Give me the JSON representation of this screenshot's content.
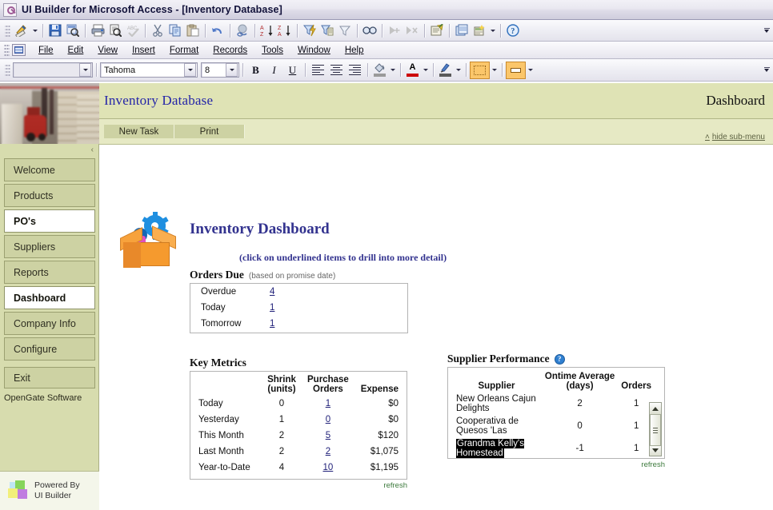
{
  "window": {
    "title": "UI Builder for Microsoft Access  - [Inventory Database]",
    "icon": "key-icon"
  },
  "menubar": {
    "items": [
      "File",
      "Edit",
      "View",
      "Insert",
      "Format",
      "Records",
      "Tools",
      "Window",
      "Help"
    ]
  },
  "toolbar": {
    "icons": [
      "design-view-icon",
      "save-icon",
      "search-replace-icon",
      "print-icon",
      "print-preview-icon",
      "spellcheck-icon",
      "cut-icon",
      "copy-icon",
      "paste-icon",
      "undo-icon",
      "insert-hyperlink-icon",
      "sort-ascending-icon",
      "sort-descending-icon",
      "filter-by-selection-icon",
      "filter-by-form-icon",
      "apply-filter-icon",
      "find-icon",
      "new-record-icon",
      "delete-record-icon",
      "properties-icon",
      "database-window-icon",
      "new-object-icon",
      "help-icon"
    ]
  },
  "formatbar": {
    "object_value": "",
    "font_value": "Tahoma",
    "size_value": "8",
    "bold_label": "B",
    "italic_label": "I",
    "underline_label": "U",
    "fill_glyph": "◢",
    "fontcolor_glyph": "A",
    "line_glyph": "✎",
    "fill_color": "#9a9a9a",
    "fontcolor_color": "#cc0000",
    "linecolor_color": "#5a5a5a"
  },
  "sidebar": {
    "collapse_glyph": "‹",
    "items": [
      {
        "label": "Welcome",
        "active": false
      },
      {
        "label": "Products",
        "active": false
      },
      {
        "label": "PO's",
        "active": true
      },
      {
        "label": "Suppliers",
        "active": false
      },
      {
        "label": "Reports",
        "active": false
      },
      {
        "label": "Dashboard",
        "active": true
      },
      {
        "label": "Company Info",
        "active": false
      },
      {
        "label": "Configure",
        "active": false
      }
    ],
    "exit_label": "Exit",
    "company": "OpenGate Software",
    "powered_line1": "Powered By",
    "powered_line2": "UI Builder"
  },
  "page_header": {
    "app_title": "Inventory Database",
    "section_title": "Dashboard",
    "buttons": [
      "New Task",
      "Print"
    ],
    "hide_submenu": "hide sub-menu",
    "hide_caret": "˄"
  },
  "dashboard": {
    "icon": "open-box-with-gears-icon",
    "title": "Inventory Dashboard",
    "subtitle": "(click on underlined items to drill into more detail)",
    "orders_due": {
      "heading": "Orders Due",
      "note": "(based on promise date)",
      "rows": [
        {
          "label": "Overdue",
          "value": "4",
          "link": true
        },
        {
          "label": "Today",
          "value": "1",
          "link": true
        },
        {
          "label": "Tomorrow",
          "value": "1",
          "link": true
        }
      ]
    },
    "key_metrics": {
      "heading": "Key Metrics",
      "columns": [
        "",
        "Shrink\n(units)",
        "Purchase\nOrders",
        "Expense"
      ],
      "col_shrink_l1": "Shrink",
      "col_shrink_l2": "(units)",
      "col_po_l1": "Purchase",
      "col_po_l2": "Orders",
      "col_expense": "Expense",
      "rows": [
        {
          "label": "Today",
          "shrink": "0",
          "orders": "1",
          "expense": "$0"
        },
        {
          "label": "Yesterday",
          "shrink": "1",
          "orders": "0",
          "expense": "$0"
        },
        {
          "label": "This Month",
          "shrink": "2",
          "orders": "5",
          "expense": "$120"
        },
        {
          "label": "Last Month",
          "shrink": "2",
          "orders": "2",
          "expense": "$1,075"
        },
        {
          "label": "Year-to-Date",
          "shrink": "4",
          "orders": "10",
          "expense": "$1,195"
        }
      ],
      "refresh": "refresh"
    },
    "supplier_performance": {
      "heading": "Supplier Performance",
      "help_glyph": "?",
      "col_supplier": "Supplier",
      "col_ontime_l1": "Ontime Average",
      "col_ontime_l2": "(days)",
      "col_orders": "Orders",
      "rows": [
        {
          "supplier": "New Orleans Cajun Delights",
          "ontime": "2",
          "orders": "1",
          "selected": false
        },
        {
          "supplier": "Cooperativa de Quesos 'Las",
          "ontime": "0",
          "orders": "1",
          "selected": false
        },
        {
          "supplier": "Grandma Kelly's Homestead",
          "ontime": "-1",
          "orders": "1",
          "selected": true
        }
      ],
      "refresh": "refresh"
    }
  },
  "colors": {
    "sidebar_bg": "#d7dcae",
    "nav_item_bg": "#cdd2a3",
    "header_band": "#dfe3b5",
    "sub_band": "#e6e9c4",
    "app_title": "#2424a8",
    "dash_title": "#33338f",
    "link": "#22227a",
    "refresh": "#3d7a3d"
  }
}
